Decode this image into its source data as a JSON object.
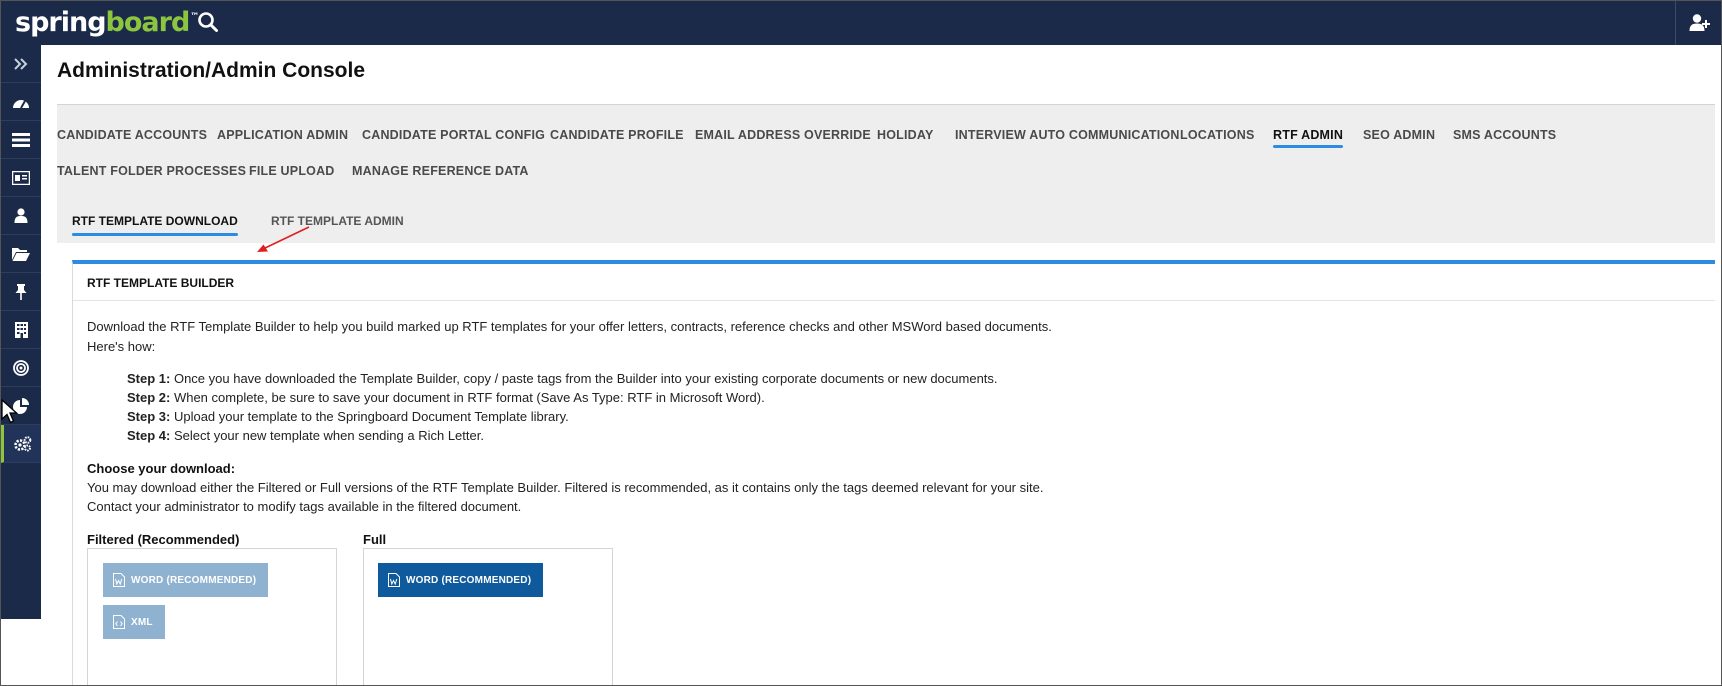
{
  "brand": {
    "name_part1": "spring",
    "name_part2": "board",
    "tm": "™",
    "primary": "#1b2a49",
    "accent": "#8cc63f",
    "tab_underline": "#2d8be2"
  },
  "topbar": {
    "search_icon": "search-icon",
    "user_icon": "add-user-icon"
  },
  "leftnav": {
    "items": [
      {
        "icon": "expand-icon"
      },
      {
        "icon": "dashboard-icon"
      },
      {
        "icon": "list-icon"
      },
      {
        "icon": "id-card-icon"
      },
      {
        "icon": "user-icon"
      },
      {
        "icon": "folder-open-icon"
      },
      {
        "icon": "pin-icon"
      },
      {
        "icon": "building-icon"
      },
      {
        "icon": "target-icon"
      },
      {
        "icon": "pie-chart-icon"
      },
      {
        "icon": "settings-gears-icon"
      }
    ]
  },
  "page": {
    "title": "Administration/Admin Console"
  },
  "tabs": [
    {
      "label": "CANDIDATE ACCOUNTS"
    },
    {
      "label": "APPLICATION ADMIN"
    },
    {
      "label": "CANDIDATE PORTAL CONFIG"
    },
    {
      "label": "CANDIDATE PROFILE"
    },
    {
      "label": "EMAIL ADDRESS OVERRIDE"
    },
    {
      "label": "HOLIDAY"
    },
    {
      "label": "INTERVIEW AUTO COMMUNICATION"
    },
    {
      "label": "LOCATIONS"
    },
    {
      "label": "RTF ADMIN",
      "active": true
    },
    {
      "label": "SEO ADMIN"
    },
    {
      "label": "SMS ACCOUNTS"
    },
    {
      "label": "TALENT FOLDER PROCESSES"
    },
    {
      "label": "FILE UPLOAD"
    },
    {
      "label": "MANAGE REFERENCE DATA"
    }
  ],
  "subtabs": [
    {
      "label": "RTF TEMPLATE DOWNLOAD",
      "active": true
    },
    {
      "label": "RTF TEMPLATE ADMIN"
    }
  ],
  "panel": {
    "title": "RTF TEMPLATE BUILDER",
    "intro_line1": "Download the RTF Template Builder to help you build marked up RTF templates for your offer letters, contracts, reference checks and other MSWord based documents.",
    "intro_line2": "Here's how:",
    "steps": [
      {
        "label": "Step 1:",
        "text": " Once you have downloaded the Template Builder, copy / paste tags from the Builder into your existing corporate documents or new documents."
      },
      {
        "label": "Step 2:",
        "text": " When complete, be sure to save your document in RTF format (Save As Type: RTF in Microsoft Word)."
      },
      {
        "label": "Step 3:",
        "text": " Upload your template to the Springboard Document Template library."
      },
      {
        "label": "Step 4:",
        "text": " Select your new template when sending a Rich Letter."
      }
    ],
    "choose_heading": "Choose your download:",
    "choose_line1": "You may download either the Filtered or Full versions of the RTF Template Builder. Filtered is recommended, as it contains only the tags deemed relevant for your site.",
    "choose_line2": "Contact your administrator to modify tags available in the filtered document.",
    "filtered": {
      "heading": "Filtered (Recommended)",
      "word_button": "WORD (RECOMMENDED)",
      "xml_button": "XML"
    },
    "full": {
      "heading": "Full",
      "word_button": "WORD (RECOMMENDED)"
    }
  }
}
